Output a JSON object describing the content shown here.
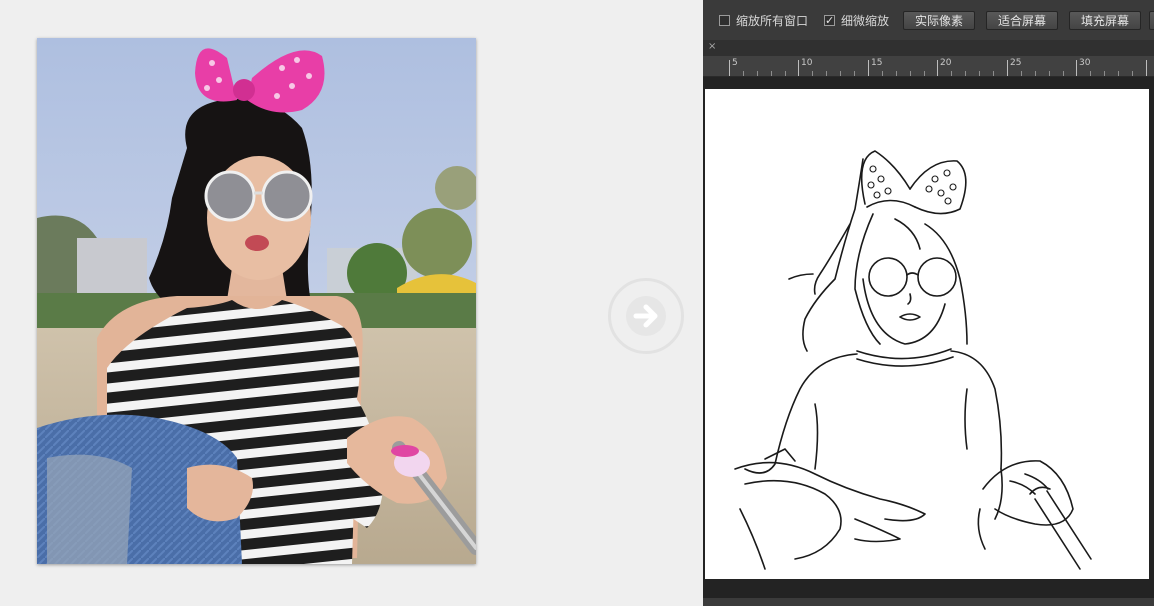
{
  "options_bar": {
    "zoom_all_windows_label": "缩放所有窗口",
    "zoom_all_windows_checked": false,
    "scrubby_zoom_label": "细微缩放",
    "scrubby_zoom_checked": true,
    "actual_pixels_label": "实际像素",
    "fit_screen_label": "适合屏幕",
    "fill_screen_label": "填充屏幕"
  },
  "ruler": {
    "ticks": [
      "5",
      "10",
      "15",
      "20",
      "25",
      "30"
    ]
  },
  "tab": {
    "close_glyph": "×"
  },
  "arrow": {
    "icon": "arrow-right-icon"
  },
  "colors": {
    "app_background": "#efefef",
    "ps_panel": "#3a3a3a",
    "canvas_background": "#232323",
    "line_art": "#1a1a1a",
    "bow_pink": "#e83ea7"
  }
}
